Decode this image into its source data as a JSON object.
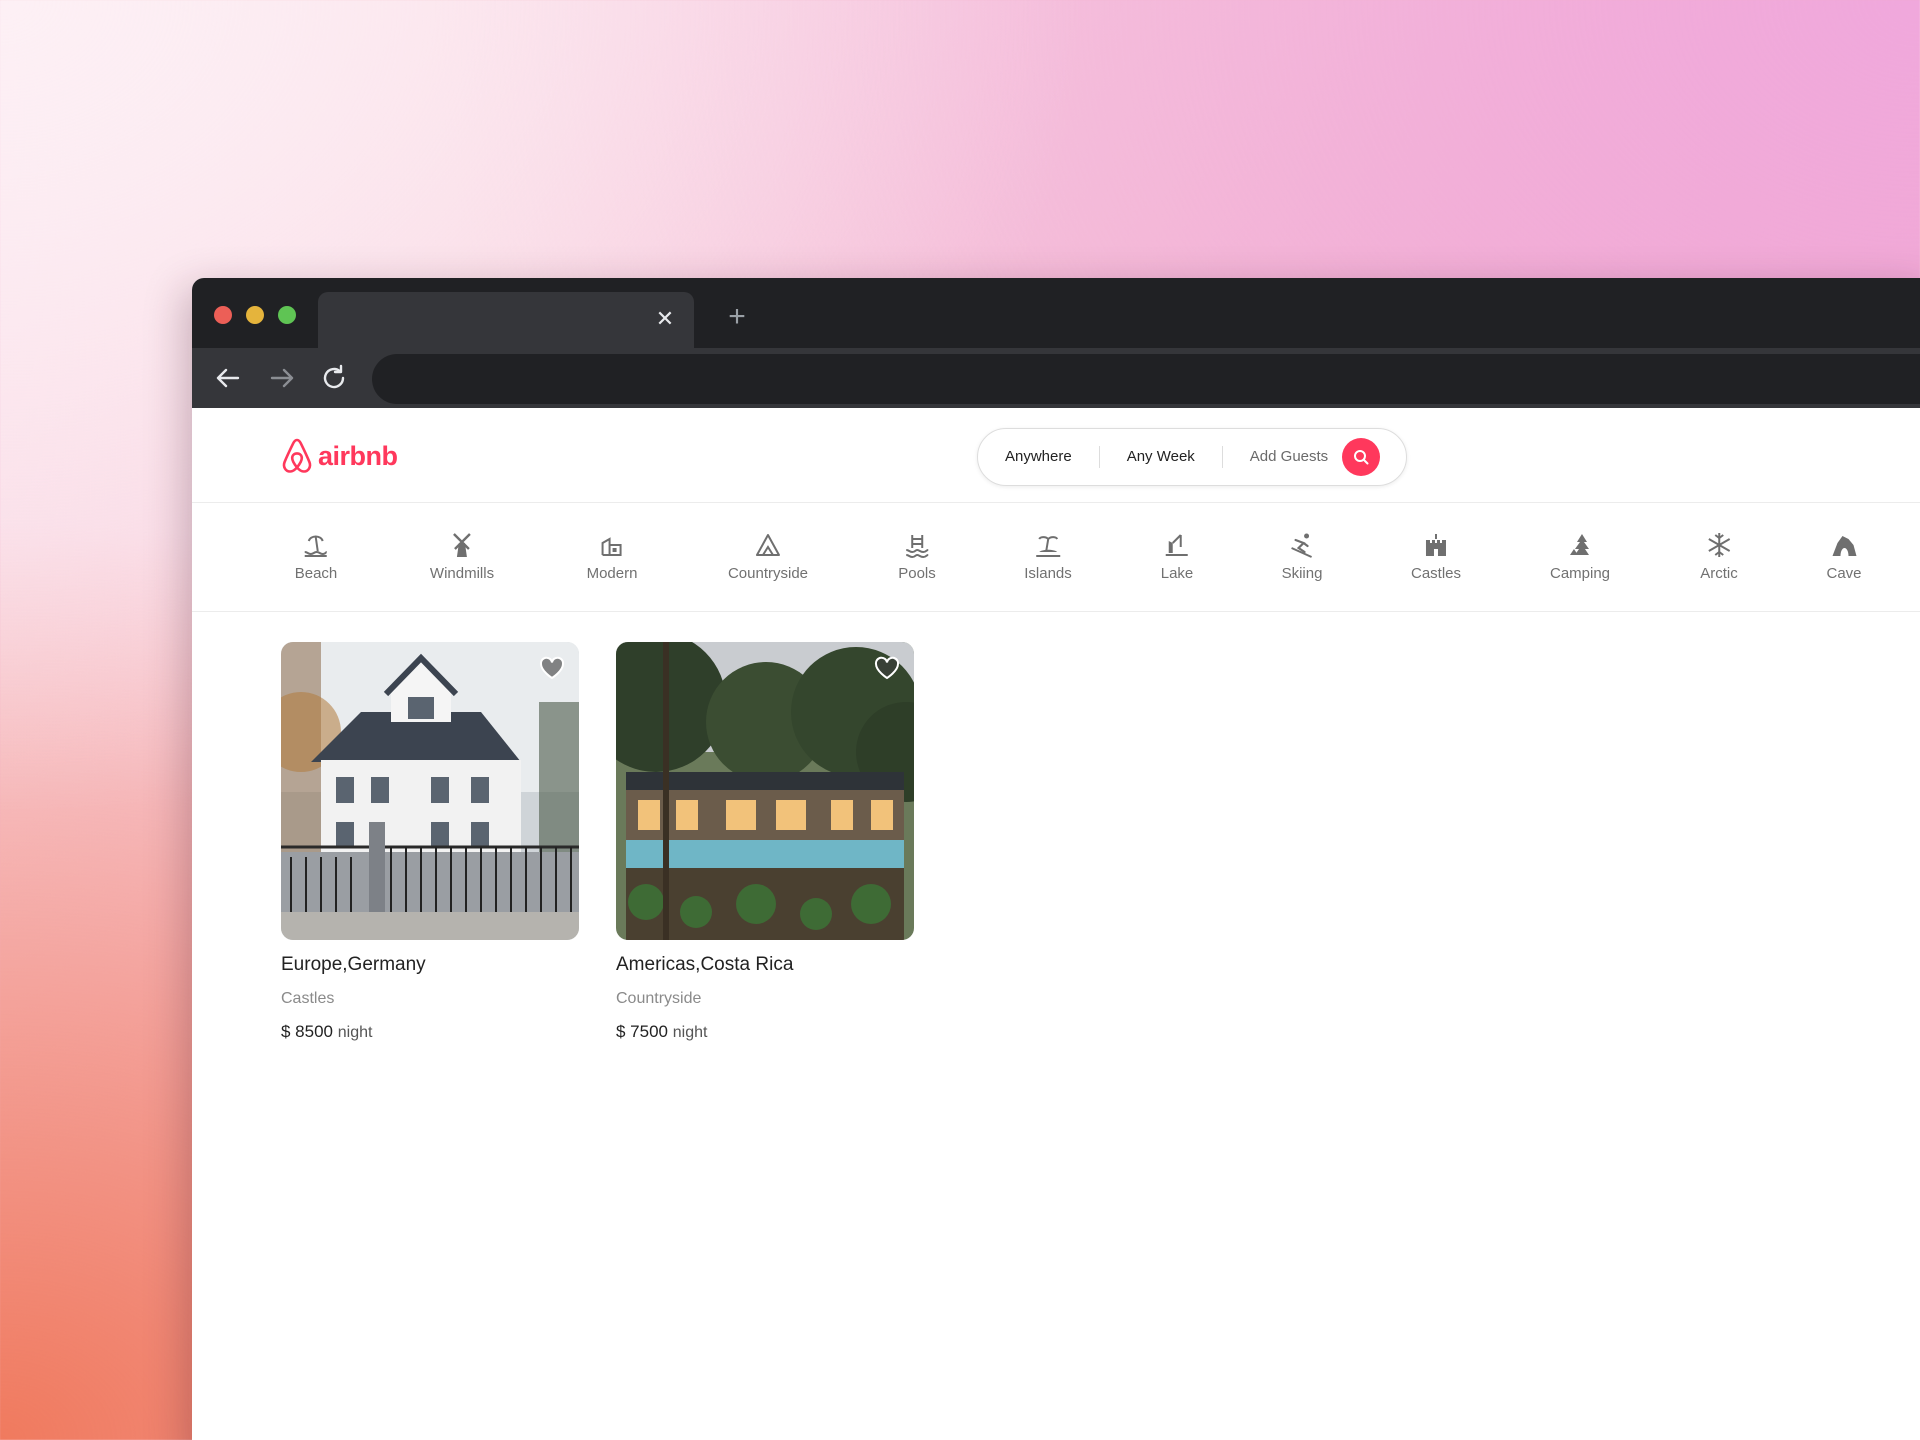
{
  "browser": {
    "tab_close": "✕",
    "new_tab": "+"
  },
  "header": {
    "logo_text": "airbnb",
    "search": {
      "where": "Anywhere",
      "when": "Any Week",
      "who": "Add Guests"
    }
  },
  "categories": [
    {
      "label": "Beach",
      "icon": "beach-icon"
    },
    {
      "label": "Windmills",
      "icon": "windmill-icon"
    },
    {
      "label": "Modern",
      "icon": "modern-house-icon"
    },
    {
      "label": "Countryside",
      "icon": "countryside-icon"
    },
    {
      "label": "Pools",
      "icon": "pool-icon"
    },
    {
      "label": "Islands",
      "icon": "island-icon"
    },
    {
      "label": "Lake",
      "icon": "lake-icon"
    },
    {
      "label": "Skiing",
      "icon": "skiing-icon"
    },
    {
      "label": "Castles",
      "icon": "castle-icon"
    },
    {
      "label": "Camping",
      "icon": "camping-icon"
    },
    {
      "label": "Arctic",
      "icon": "snowflake-icon"
    },
    {
      "label": "Cave",
      "icon": "cave-icon"
    }
  ],
  "listings": [
    {
      "location": "Europe,Germany",
      "category": "Castles",
      "price": "$ 8500",
      "unit": "night",
      "image": "white-villa-photo"
    },
    {
      "location": "Americas,Costa Rica",
      "category": "Countryside",
      "price": "$ 7500",
      "unit": "night",
      "image": "jungle-pool-villa-photo"
    }
  ],
  "colors": {
    "brand": "#ff385c",
    "text": "#222222",
    "muted": "#717171"
  }
}
